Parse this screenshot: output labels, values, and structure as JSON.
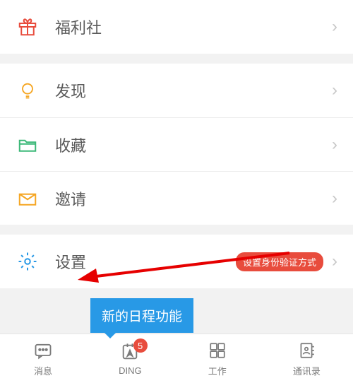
{
  "menu": {
    "welfare": {
      "label": "福利社"
    },
    "discover": {
      "label": "发现"
    },
    "favorites": {
      "label": "收藏"
    },
    "invite": {
      "label": "邀请"
    },
    "settings": {
      "label": "设置",
      "badge": "设置身份验证方式"
    }
  },
  "tooltip": {
    "text": "新的日程功能"
  },
  "tabbar": {
    "messages": {
      "label": "消息"
    },
    "ding": {
      "label": "DING",
      "badge": "5"
    },
    "work": {
      "label": "工作"
    },
    "contacts": {
      "label": "通讯录"
    }
  }
}
